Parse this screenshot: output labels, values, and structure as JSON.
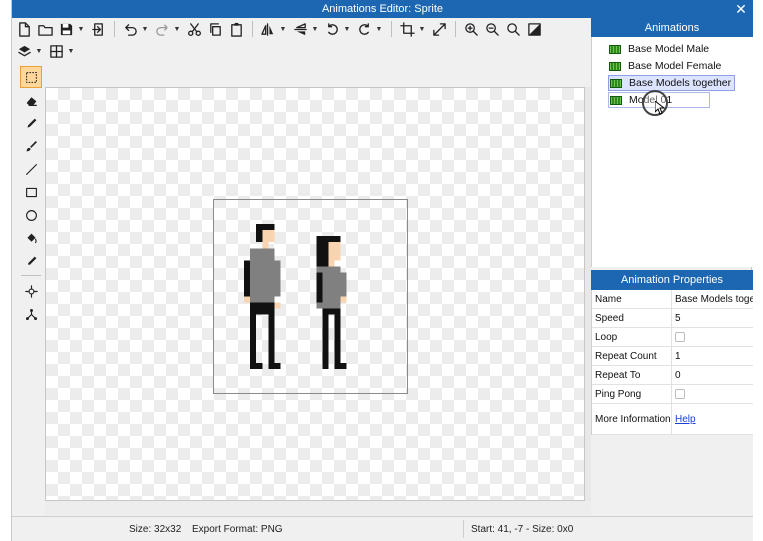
{
  "window": {
    "title": "Animations Editor: Sprite"
  },
  "toolbar": {
    "row1": [
      {
        "name": "new-file-icon",
        "icon": "file"
      },
      {
        "name": "open-folder-icon",
        "icon": "folder"
      },
      {
        "name": "save-icon",
        "icon": "floppy",
        "dropdown": true
      },
      {
        "name": "export-icon",
        "icon": "export"
      },
      {
        "sep": true
      },
      {
        "name": "undo-icon",
        "icon": "undo",
        "dropdown": true
      },
      {
        "name": "redo-icon",
        "icon": "redo",
        "dropdown": true
      },
      {
        "name": "cut-icon",
        "icon": "scissors"
      },
      {
        "name": "copy-icon",
        "icon": "copy"
      },
      {
        "name": "paste-icon",
        "icon": "clipboard"
      },
      {
        "sep": true
      },
      {
        "name": "flip-horizontal-icon",
        "icon": "flip-h",
        "dropdown": true
      },
      {
        "name": "flip-vertical-icon",
        "icon": "flip-v",
        "dropdown": true
      },
      {
        "name": "rotate-left-icon",
        "icon": "rotate-l",
        "dropdown": true
      },
      {
        "name": "rotate-right-icon",
        "icon": "rotate-r",
        "dropdown": true
      },
      {
        "sep": true
      },
      {
        "name": "crop-icon",
        "icon": "crop",
        "dropdown": true
      },
      {
        "name": "resize-icon",
        "icon": "resize"
      },
      {
        "sep": true
      },
      {
        "name": "zoom-in-icon",
        "icon": "zoom-in"
      },
      {
        "name": "zoom-out-icon",
        "icon": "zoom-out"
      },
      {
        "name": "zoom-fit-icon",
        "icon": "zoom"
      },
      {
        "name": "background-toggle-icon",
        "icon": "bg"
      }
    ],
    "row2": [
      {
        "name": "layers-icon",
        "icon": "layers",
        "dropdown": true
      },
      {
        "name": "grid-icon",
        "icon": "grid",
        "dropdown": true
      }
    ]
  },
  "tools": [
    {
      "name": "select-tool-icon",
      "icon": "select",
      "active": true
    },
    {
      "name": "eraser-tool-icon",
      "icon": "eraser"
    },
    {
      "name": "pencil-tool-icon",
      "icon": "pencil"
    },
    {
      "name": "brush-tool-icon",
      "icon": "brush"
    },
    {
      "name": "line-tool-icon",
      "icon": "line"
    },
    {
      "name": "rectangle-tool-icon",
      "icon": "rect"
    },
    {
      "name": "ellipse-tool-icon",
      "icon": "ellipse"
    },
    {
      "name": "fill-tool-icon",
      "icon": "bucket"
    },
    {
      "name": "eyedropper-tool-icon",
      "icon": "dropper"
    },
    {
      "sep": true
    },
    {
      "name": "pivot-tool-icon",
      "icon": "pivot"
    },
    {
      "name": "bones-tool-icon",
      "icon": "bones"
    }
  ],
  "animations": {
    "header": "Animations",
    "items": [
      {
        "label": "Base Model Male",
        "state": "normal"
      },
      {
        "label": "Base Model Female",
        "state": "normal"
      },
      {
        "label": "Base Models together",
        "state": "selected"
      },
      {
        "label": "Model 01",
        "state": "editing"
      }
    ]
  },
  "properties": {
    "header": "Animation Properties",
    "rows": [
      {
        "name": "Name",
        "value": "Base Models together",
        "type": "text"
      },
      {
        "name": "Speed",
        "value": "5",
        "type": "text"
      },
      {
        "name": "Loop",
        "value": "",
        "type": "checkbox"
      },
      {
        "name": "Repeat Count",
        "value": "1",
        "type": "text"
      },
      {
        "name": "Repeat To",
        "value": "0",
        "type": "text"
      },
      {
        "name": "Ping Pong",
        "value": "",
        "type": "checkbox"
      },
      {
        "name": "More Information",
        "value": "Help",
        "type": "link"
      }
    ]
  },
  "status": {
    "size": "Size: 32x32",
    "export_format": "Export Format: PNG",
    "cursor": "Start: 41, -7 - Size: 0x0"
  },
  "colors": {
    "accent": "#1d67b2",
    "hair": "#111111",
    "shirt": "#808080",
    "skin": "#f8d5b0",
    "pants": "#111111"
  }
}
